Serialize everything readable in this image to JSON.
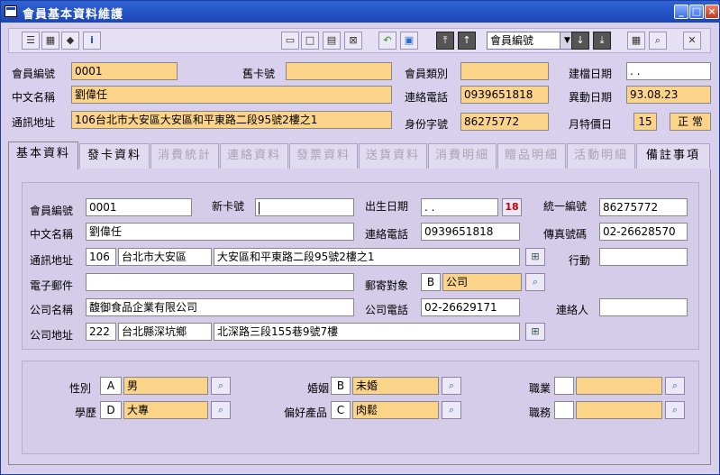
{
  "window": {
    "title": "會員基本資料維護"
  },
  "toolbar": {
    "combo_value": "會員編號"
  },
  "header": {
    "member_no_label": "會員編號",
    "member_no": "0001",
    "old_card_label": "舊卡號",
    "old_card": "",
    "member_type_label": "會員類別",
    "member_type": "",
    "created_label": "建檔日期",
    "created": ". .",
    "name_label": "中文名稱",
    "name": "劉偉任",
    "phone_label": "連絡電話",
    "phone": "0939651818",
    "changed_label": "異動日期",
    "changed": "93.08.23",
    "address_label": "通訊地址",
    "address": "106台北市大安區大安區和平東路二段95號2樓之1",
    "idno_label": "身份字號",
    "idno": "86275772",
    "monthly_label": "月特價日",
    "monthly": "15",
    "status": "正 常"
  },
  "tabs": [
    "基本資料",
    "發卡資料",
    "消費統計",
    "連絡資料",
    "發票資料",
    "送貨資料",
    "消費明細",
    "贈品明細",
    "活動明細",
    "備註事項"
  ],
  "detail": {
    "member_no_label": "會員編號",
    "member_no": "0001",
    "new_card_label": "新卡號",
    "new_card": "",
    "birth_label": "出生日期",
    "birth": ". .",
    "tax_label": "統一編號",
    "tax": "86275772",
    "name_label": "中文名稱",
    "name": "劉偉任",
    "phone_label": "連絡電話",
    "phone": "0939651818",
    "fax_label": "傳真號碼",
    "fax": "02-26628570",
    "address_label": "通訊地址",
    "zip": "106",
    "city": "台北市大安區",
    "street": "大安區和平東路二段95號2樓之1",
    "mobile_label": "行動",
    "mobile": "",
    "email_label": "電子郵件",
    "email": "",
    "mail_target_label": "郵寄對象",
    "mail_code": "B",
    "mail_target": "公司",
    "company_label": "公司名稱",
    "company": "馥御食品企業有限公司",
    "company_phone_label": "公司電話",
    "company_phone": "02-26629171",
    "contact_label": "連絡人",
    "contact": "",
    "company_addr_label": "公司地址",
    "company_zip": "222",
    "company_city": "台北縣深坑鄉",
    "company_street": "北深路三段155巷9號7樓"
  },
  "profile": {
    "gender_label": "性別",
    "gender_code": "A",
    "gender": "男",
    "marital_label": "婚姻",
    "marital_code": "B",
    "marital": "未婚",
    "job_label": "職業",
    "job_code": "",
    "job": "",
    "edu_label": "學歷",
    "edu_code": "D",
    "edu": "大專",
    "pref_label": "偏好產品",
    "pref_code": "C",
    "pref": "肉鬆",
    "duty_label": "職務",
    "duty_code": "",
    "duty": ""
  }
}
